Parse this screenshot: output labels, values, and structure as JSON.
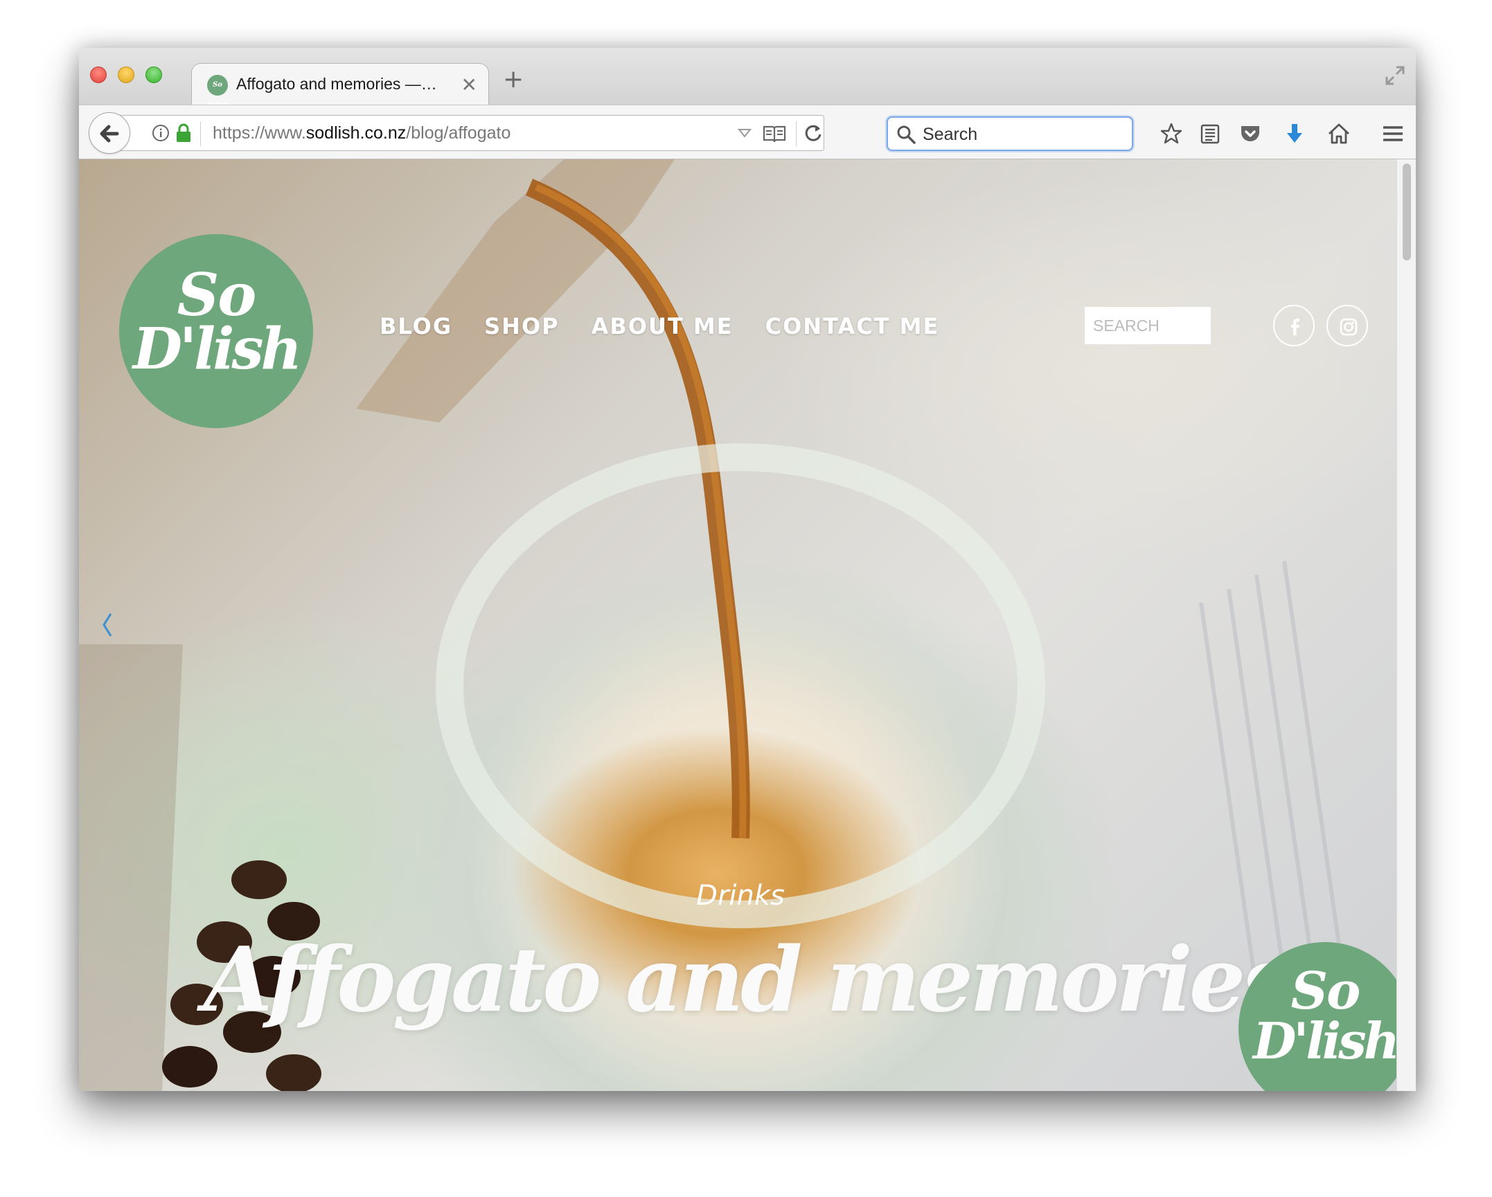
{
  "browser": {
    "tab": {
      "title": "Affogato and memories —…",
      "favicon_text": "So D'lish",
      "close": "✕"
    },
    "new_tab": "+",
    "url": {
      "scheme": "https://www.",
      "host": "sodlish.co.nz",
      "path": "/blog/affogato"
    },
    "search_placeholder": "Search"
  },
  "site": {
    "logo": {
      "line1": "So",
      "line2": "D'lish"
    },
    "nav": [
      "BLOG",
      "SHOP",
      "ABOUT ME",
      "CONTACT ME"
    ],
    "search_placeholder": "SEARCH",
    "social": [
      "facebook-icon",
      "instagram-icon"
    ]
  },
  "post": {
    "category": "Drinks",
    "title": "Affogato and memories",
    "badge": {
      "line1": "So",
      "line2": "D'lish"
    }
  },
  "colors": {
    "brand_green": "#6fa77c",
    "accent_blue": "#2b88d8"
  }
}
